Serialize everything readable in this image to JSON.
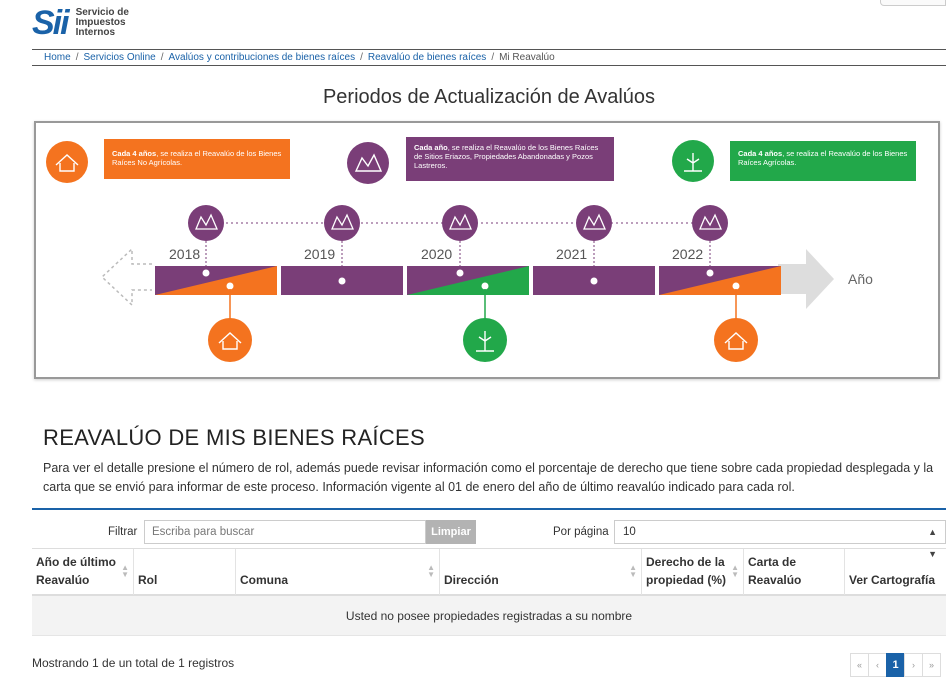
{
  "header": {
    "logo_mark": "Sii",
    "logo_line1": "Servicio de",
    "logo_line2": "Impuestos",
    "logo_line3": "Internos"
  },
  "breadcrumb": {
    "items": [
      "Home",
      "Servicios Online",
      "Avalúos y contribuciones de bienes raíces",
      "Reavalúo de bienes raíces"
    ],
    "current": "Mi Reavalúo"
  },
  "infographic": {
    "title": "Periodos de Actualización de Avalúos",
    "callout_orange_bold": "Cada 4 años",
    "callout_orange_text": ", se realiza el Reavalúo de los Bienes Raíces No Agrícolas.",
    "callout_purple_bold": "Cada año",
    "callout_purple_text": ", se realiza el Reavalúo de los Bienes Raíces de Sitios Eriazos, Propiedades Abandonadas y Pozos Lastreros.",
    "callout_green_bold": "Cada 4 años",
    "callout_green_text": ", se realiza el Reavalúo de los Bienes Raíces Agrícolas.",
    "years": [
      "2018",
      "2019",
      "2020",
      "2021",
      "2022"
    ],
    "axis_label": "Año",
    "colors": {
      "orange": "#f4731f",
      "purple": "#7a3e78",
      "green": "#22a84a",
      "arrow": "#dddddd"
    }
  },
  "section": {
    "title": "REAVALÚO DE MIS BIENES RAÍCES",
    "description": "Para ver el detalle presione el número de rol, además puede revisar información como el porcentaje de derecho que tiene sobre cada propiedad desplegada y la carta que se envió para informar de este proceso. Información vigente al 01 de enero del año de último reavalúo indicado para cada rol."
  },
  "filters": {
    "filter_label": "Filtrar",
    "search_placeholder": "Escriba para buscar",
    "clear_label": "Limpiar",
    "per_page_label": "Por página",
    "per_page_value": "10"
  },
  "table": {
    "columns": [
      "Año de último Reavalúo",
      "Rol",
      "Comuna",
      "Dirección",
      "Derecho de la propiedad (%)",
      "Carta de Reavalúo",
      "Ver Cartografía"
    ],
    "col_ultimo_1": "Año de último",
    "col_ultimo_2": "Reavalúo",
    "col_derecho_1": "Derecho de la",
    "col_derecho_2": "propiedad (%)",
    "col_carta_1": "Carta de",
    "col_carta_2": "Reavalúo",
    "empty_message": "Usted no posee propiedades registradas a su nombre"
  },
  "footer": {
    "info": "Mostrando 1 de un total de 1 registros",
    "pager": [
      "«",
      "‹",
      "1",
      "›",
      "»"
    ]
  }
}
